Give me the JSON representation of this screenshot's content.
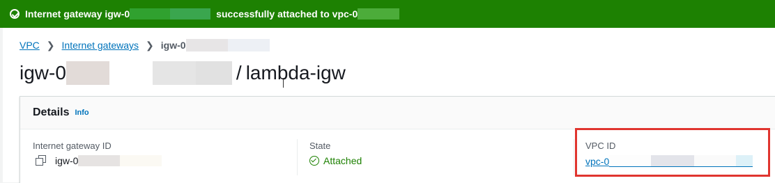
{
  "flash": {
    "prefix": "Internet gateway igw-0",
    "middle": "successfully attached to vpc-0",
    "color": "#1d8102"
  },
  "breadcrumb": {
    "items": [
      "VPC",
      "Internet gateways"
    ],
    "current": "igw-0"
  },
  "title": {
    "id_prefix": "igw-0",
    "separator": "/",
    "name": "lambda-igw"
  },
  "details": {
    "heading": "Details",
    "info_link": "Info",
    "fields": {
      "gateway_id_label": "Internet gateway ID",
      "gateway_id_value": "igw-0",
      "state_label": "State",
      "state_value": "Attached",
      "vpc_id_label": "VPC ID",
      "vpc_id_value": "vpc-0"
    }
  },
  "icons": [
    "success-check-icon",
    "chevron-right-icon",
    "copy-icon",
    "status-success-icon"
  ]
}
